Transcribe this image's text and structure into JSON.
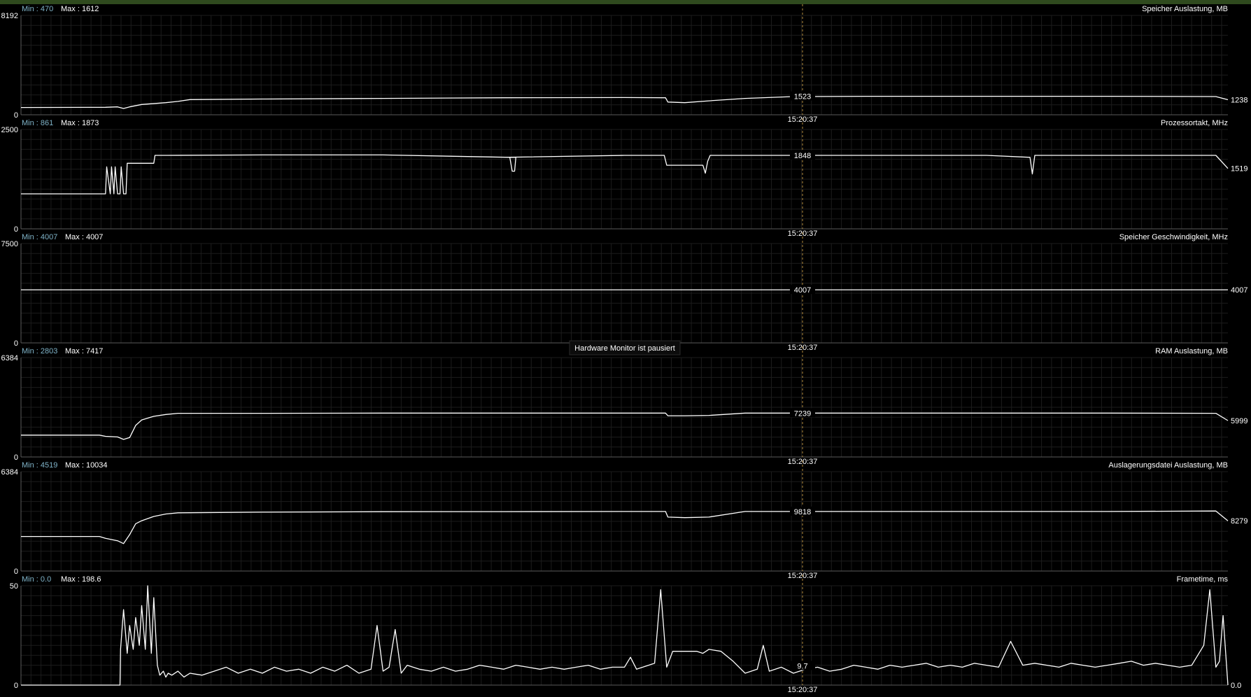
{
  "paused_label": "Hardware Monitor ist pausiert",
  "colors": {
    "background": "#000000",
    "grid": "#1c1c1c",
    "axis": "#5a5a5a",
    "line": "#ffffff",
    "min_label": "#7fb3c8",
    "text": "#ffffff",
    "cursor": "#b58c3c",
    "topbar": "#2f4a1e"
  },
  "chart_data": [
    {
      "type": "line",
      "title": "Speicher Auslastung, MB",
      "min_label": "Min : 470",
      "max_label": "Max : 1612",
      "ylim": [
        0,
        8192
      ],
      "ytick_top": "8192",
      "ytick_bottom": "0",
      "cursor_time": "15:20:37",
      "cursor_value_label": "1523",
      "end_value_label": "1238",
      "series": [
        {
          "x": [
            0,
            0.07,
            0.08,
            0.085,
            0.09,
            0.1,
            0.12,
            0.13,
            0.14,
            0.2,
            0.3,
            0.4,
            0.5,
            0.534,
            0.536,
            0.55,
            0.57,
            0.6,
            0.64,
            0.7,
            0.8,
            0.9,
            0.99,
            1
          ],
          "y": [
            600,
            620,
            650,
            520,
            650,
            850,
            1000,
            1100,
            1250,
            1300,
            1350,
            1400,
            1420,
            1400,
            1050,
            1000,
            1150,
            1350,
            1500,
            1523,
            1523,
            1523,
            1500,
            1238
          ]
        }
      ]
    },
    {
      "type": "line",
      "title": "Prozessortakt, MHz",
      "min_label": "Min : 861",
      "max_label": "Max : 1873",
      "ylim": [
        0,
        2500
      ],
      "ytick_top": "2500",
      "ytick_bottom": "0",
      "cursor_time": "15:20:37",
      "cursor_value_label": "1848",
      "end_value_label": "1519",
      "series": [
        {
          "x": [
            0,
            0.07,
            0.071,
            0.074,
            0.075,
            0.077,
            0.078,
            0.08,
            0.081,
            0.082,
            0.083,
            0.085,
            0.086,
            0.087,
            0.088,
            0.09,
            0.091,
            0.11,
            0.111,
            0.12,
            0.2,
            0.3,
            0.405,
            0.407,
            0.409,
            0.41,
            0.4,
            0.5,
            0.533,
            0.535,
            0.565,
            0.567,
            0.569,
            0.571,
            0.6,
            0.7,
            0.8,
            0.836,
            0.838,
            0.84,
            0.9,
            0.99,
            1
          ],
          "y": [
            880,
            880,
            1560,
            880,
            1560,
            880,
            1560,
            880,
            880,
            880,
            1560,
            880,
            880,
            880,
            1650,
            1650,
            1650,
            1650,
            1848,
            1848,
            1860,
            1860,
            1800,
            1450,
            1450,
            1800,
            1800,
            1848,
            1848,
            1600,
            1600,
            1400,
            1700,
            1848,
            1848,
            1848,
            1848,
            1800,
            1380,
            1848,
            1848,
            1848,
            1519
          ]
        }
      ]
    },
    {
      "type": "line",
      "title": "Speicher Geschwindigkeit, MHz",
      "min_label": "Min : 4007",
      "max_label": "Max : 4007",
      "ylim": [
        0,
        7500
      ],
      "ytick_top": "7500",
      "ytick_bottom": "0",
      "cursor_time": "15:20:37",
      "cursor_value_label": "4007",
      "end_value_label": "4007",
      "series": [
        {
          "x": [
            0,
            1
          ],
          "y": [
            4007,
            4007
          ]
        }
      ]
    },
    {
      "type": "line",
      "title": "RAM Auslastung, MB",
      "min_label": "Min : 2803",
      "max_label": "Max : 7417",
      "ylim": [
        0,
        16384
      ],
      "ytick_top": "6384",
      "ytick_bottom": "0",
      "cursor_time": "15:20:37",
      "cursor_value_label": "7239",
      "end_value_label": "5999",
      "series": [
        {
          "x": [
            0,
            0.065,
            0.07,
            0.08,
            0.085,
            0.09,
            0.095,
            0.1,
            0.11,
            0.12,
            0.13,
            0.2,
            0.3,
            0.4,
            0.5,
            0.534,
            0.536,
            0.55,
            0.57,
            0.6,
            0.64,
            0.7,
            0.8,
            0.9,
            0.99,
            1
          ],
          "y": [
            3600,
            3600,
            3400,
            3300,
            2900,
            3200,
            5200,
            6100,
            6700,
            7000,
            7200,
            7200,
            7230,
            7240,
            7240,
            7240,
            6800,
            6800,
            6850,
            7239,
            7239,
            7239,
            7239,
            7239,
            7200,
            5999
          ]
        }
      ]
    },
    {
      "type": "line",
      "title": "Auslagerungsdatei Auslastung, MB",
      "min_label": "Min : 4519",
      "max_label": "Max : 10034",
      "ylim": [
        0,
        16384
      ],
      "ytick_top": "6384",
      "ytick_bottom": "0",
      "cursor_time": "15:20:37",
      "cursor_value_label": "9818",
      "end_value_label": "8279",
      "series": [
        {
          "x": [
            0,
            0.065,
            0.07,
            0.08,
            0.085,
            0.09,
            0.095,
            0.1,
            0.11,
            0.12,
            0.13,
            0.2,
            0.3,
            0.4,
            0.5,
            0.534,
            0.536,
            0.55,
            0.57,
            0.6,
            0.64,
            0.7,
            0.8,
            0.9,
            0.99,
            1
          ],
          "y": [
            5700,
            5700,
            5400,
            5000,
            4519,
            6000,
            7800,
            8300,
            9000,
            9400,
            9600,
            9700,
            9780,
            9800,
            9818,
            9818,
            8900,
            8800,
            8900,
            9818,
            9818,
            9818,
            9818,
            9818,
            9900,
            8279
          ]
        }
      ]
    },
    {
      "type": "line",
      "title": "Frametime, ms",
      "min_label": "Min : 0.0",
      "max_label": "Max : 198.6",
      "ylim": [
        0,
        50
      ],
      "ytick_top": "50",
      "ytick_bottom": "0",
      "cursor_time": "15:20:37",
      "cursor_value_label": "9.7",
      "end_value_label": "0.0",
      "series": [
        {
          "x": [
            0,
            0.082,
            0.0825,
            0.085,
            0.088,
            0.09,
            0.093,
            0.095,
            0.098,
            0.1,
            0.103,
            0.105,
            0.108,
            0.11,
            0.113,
            0.115,
            0.118,
            0.12,
            0.122,
            0.125,
            0.13,
            0.135,
            0.14,
            0.15,
            0.16,
            0.17,
            0.18,
            0.19,
            0.2,
            0.21,
            0.22,
            0.23,
            0.24,
            0.25,
            0.26,
            0.27,
            0.28,
            0.29,
            0.295,
            0.3,
            0.305,
            0.31,
            0.315,
            0.32,
            0.33,
            0.34,
            0.35,
            0.36,
            0.37,
            0.38,
            0.39,
            0.4,
            0.41,
            0.42,
            0.43,
            0.44,
            0.45,
            0.46,
            0.47,
            0.48,
            0.49,
            0.5,
            0.505,
            0.51,
            0.52,
            0.525,
            0.53,
            0.535,
            0.54,
            0.56,
            0.565,
            0.57,
            0.58,
            0.59,
            0.6,
            0.61,
            0.615,
            0.62,
            0.63,
            0.64,
            0.65,
            0.66,
            0.67,
            0.68,
            0.69,
            0.7,
            0.71,
            0.72,
            0.73,
            0.74,
            0.75,
            0.76,
            0.77,
            0.78,
            0.79,
            0.8,
            0.81,
            0.82,
            0.83,
            0.84,
            0.85,
            0.86,
            0.87,
            0.88,
            0.89,
            0.9,
            0.91,
            0.92,
            0.93,
            0.94,
            0.95,
            0.96,
            0.97,
            0.98,
            0.985,
            0.99,
            0.993,
            0.996,
            1
          ],
          "y": [
            0,
            0,
            18,
            38,
            16,
            30,
            18,
            34,
            20,
            40,
            18,
            50,
            16,
            44,
            10,
            5,
            7,
            4,
            6,
            5,
            7,
            4,
            6,
            5,
            7,
            9,
            6,
            8,
            6,
            9,
            7,
            8,
            6,
            9,
            7,
            10,
            6,
            8,
            30,
            7,
            9,
            28,
            6,
            10,
            8,
            7,
            9,
            7,
            8,
            10,
            9,
            8,
            10,
            9,
            8,
            9,
            8,
            9,
            10,
            8,
            9,
            9,
            14,
            8,
            10,
            11,
            48,
            9,
            17,
            17,
            16,
            18,
            17,
            12,
            6,
            8,
            20,
            7,
            9,
            6,
            8,
            9,
            7,
            8,
            10,
            9,
            8,
            10,
            9,
            10,
            11,
            9,
            10,
            9,
            11,
            10,
            9,
            22,
            10,
            11,
            10,
            9,
            11,
            10,
            9,
            10,
            11,
            12,
            10,
            11,
            10,
            9,
            10,
            20,
            48,
            9,
            12,
            35,
            0
          ]
        }
      ]
    }
  ]
}
